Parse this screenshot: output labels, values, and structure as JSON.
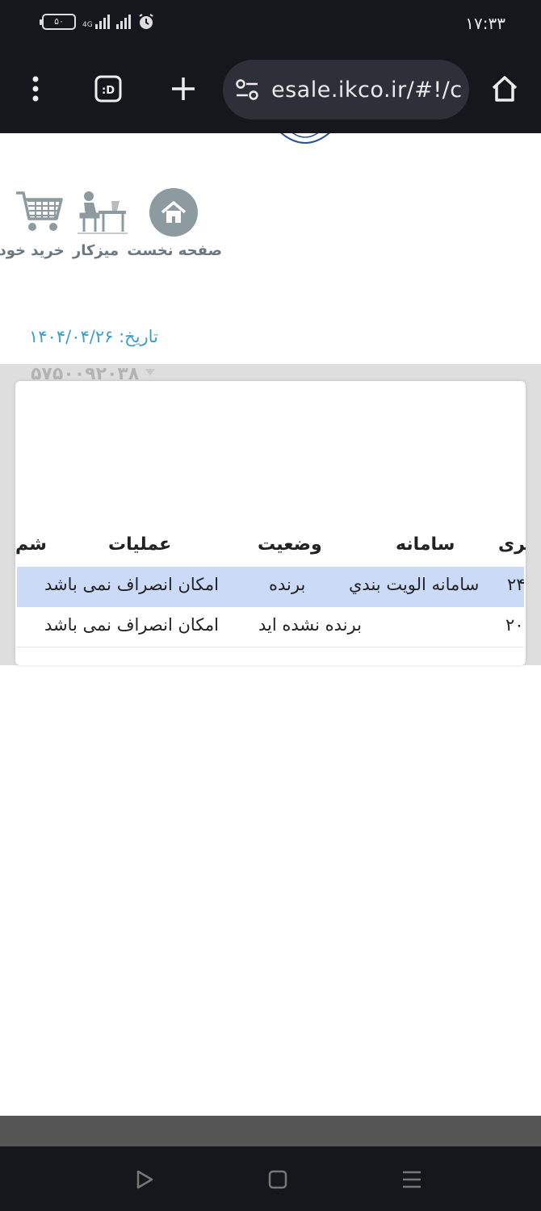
{
  "status_bar": {
    "time": "۱۷:۳۳",
    "battery": "۵۰",
    "network": "4G"
  },
  "browser": {
    "url": "esale.ikco.ir/#!/c",
    "icons": [
      "home-icon",
      "site-settings-icon",
      "new-tab-icon",
      "tab-switcher-icon",
      "more-menu-icon"
    ]
  },
  "nav": {
    "items": [
      {
        "label": "صفحه نخست",
        "icon": "home-icon"
      },
      {
        "label": "میزکار",
        "icon": "desk-icon"
      },
      {
        "label": "خرید خودرو",
        "icon": "cart-icon"
      }
    ]
  },
  "page": {
    "date": "تاریخ: ۱۴۰۴/۰۴/۲۶",
    "obscured_number": "۵۷۵۰۰۹۲۰۳۸"
  },
  "table": {
    "headers": {
      "code": "شم",
      "operations": "عملیات",
      "status": "وضعیت",
      "system": "سامانه",
      "id": "بری"
    },
    "rows": [
      {
        "id": "۲۴",
        "system": "سامانه الويت بندي",
        "status": "برنده",
        "operations": "امکان انصراف نمی باشد",
        "selected": true
      },
      {
        "id": "۲۰",
        "system": "",
        "status": "برنده نشده اید",
        "operations": "امکان انصراف نمی باشد",
        "selected": false
      }
    ]
  },
  "colors": {
    "dark_chrome": "#16171c",
    "url_bar": "#2e3039",
    "accent_date": "#3ba0c7",
    "selected_row": "#cbdaf7",
    "icon_gray": "#8d9aa0"
  }
}
